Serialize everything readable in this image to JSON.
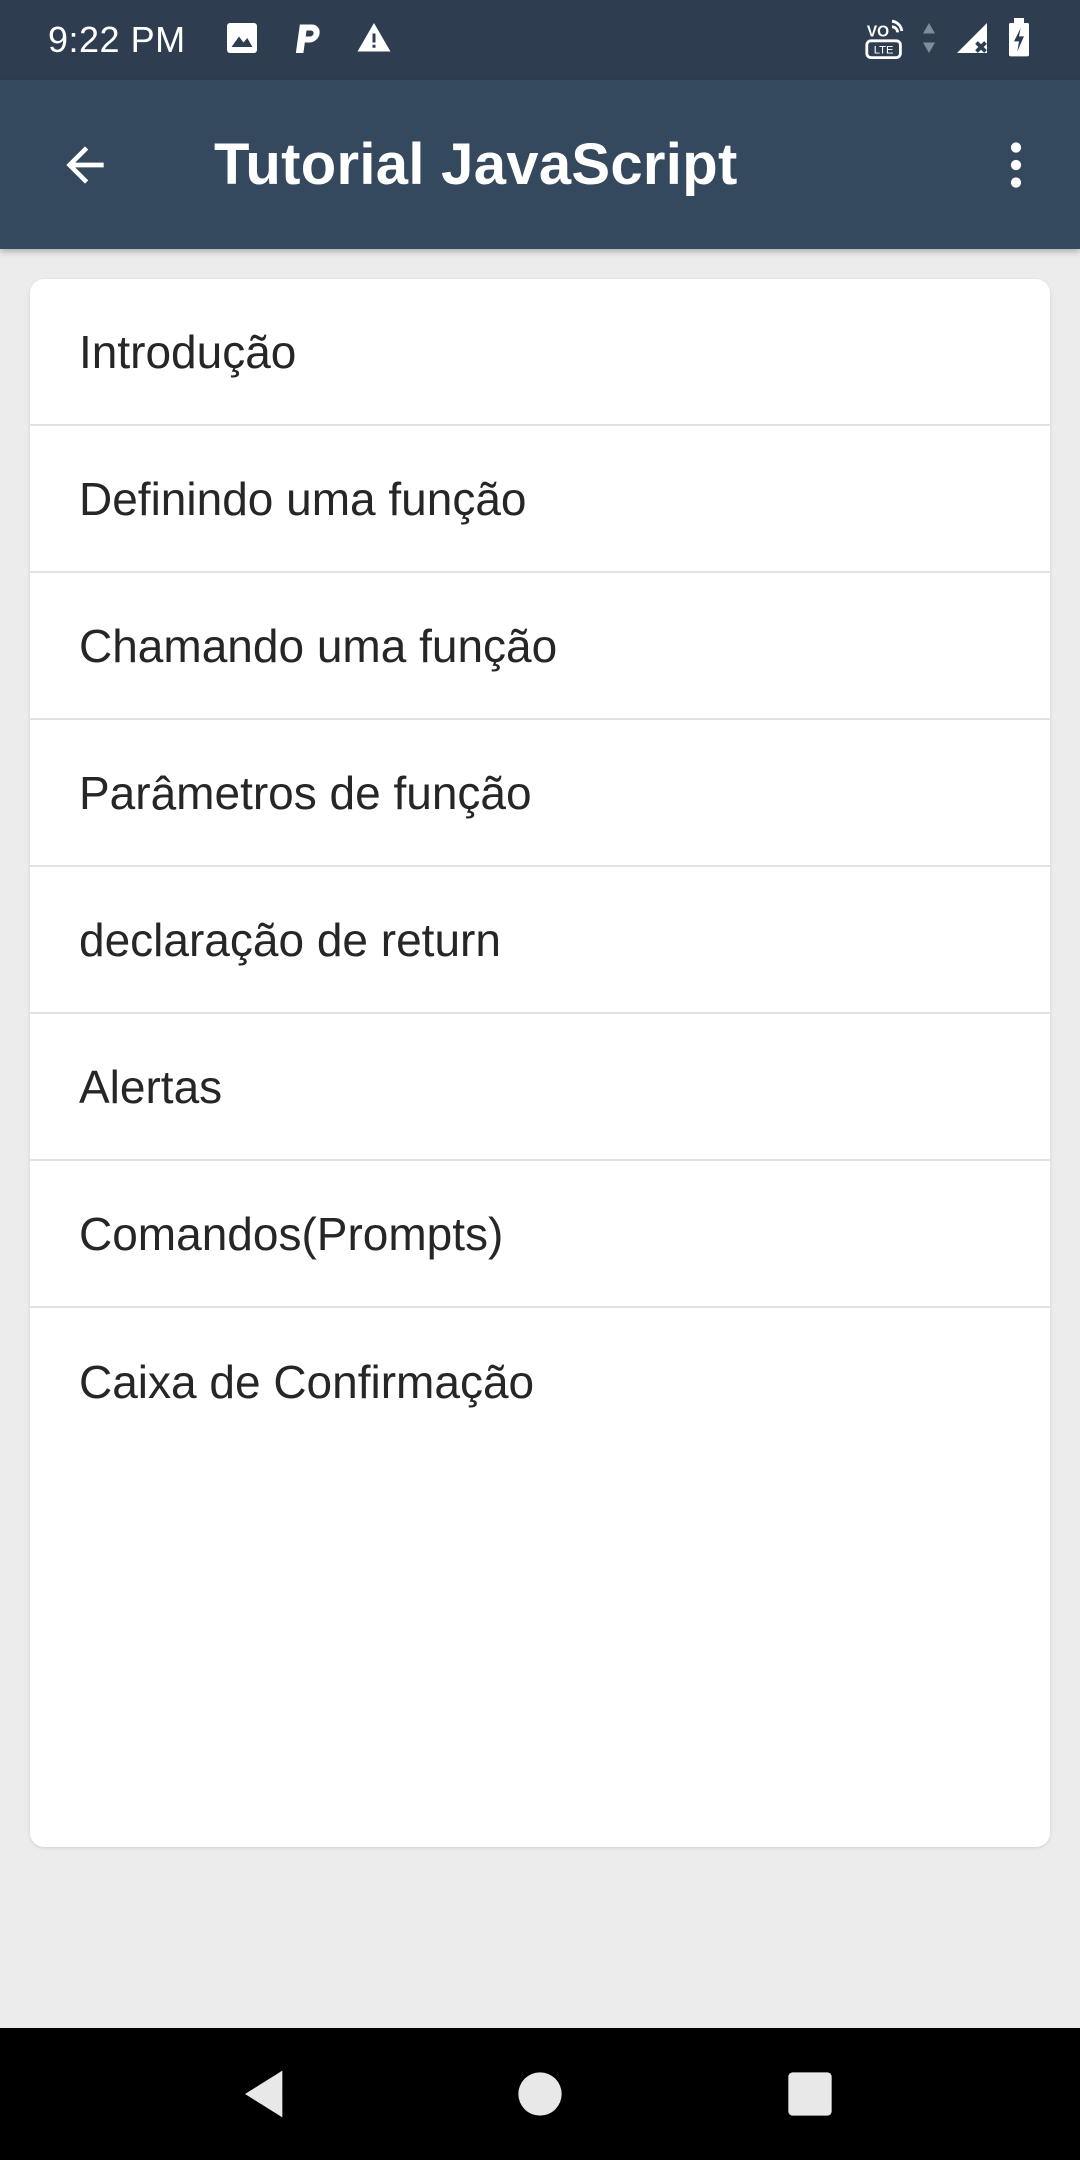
{
  "status_bar": {
    "time": "9:22 PM",
    "icons": [
      "image-icon",
      "p-icon",
      "warning-icon",
      "volte-icon",
      "data-arrows-icon",
      "signal-icon",
      "battery-icon"
    ],
    "volte_label": "VO LTE"
  },
  "app_bar": {
    "title": "Tutorial JavaScript",
    "background": "#35495e",
    "icons": [
      "back-arrow-icon",
      "more-vert-icon"
    ]
  },
  "topics": [
    {
      "label": "Introdução"
    },
    {
      "label": "Definindo uma função"
    },
    {
      "label": "Chamando uma função"
    },
    {
      "label": "Parâmetros de função"
    },
    {
      "label": "declaração de return"
    },
    {
      "label": "Alertas"
    },
    {
      "label": "Comandos(Prompts)"
    },
    {
      "label": "Caixa de Confirmação"
    }
  ],
  "nav_bar": {
    "icons": [
      "nav-back-icon",
      "nav-home-icon",
      "nav-recents-icon"
    ]
  }
}
